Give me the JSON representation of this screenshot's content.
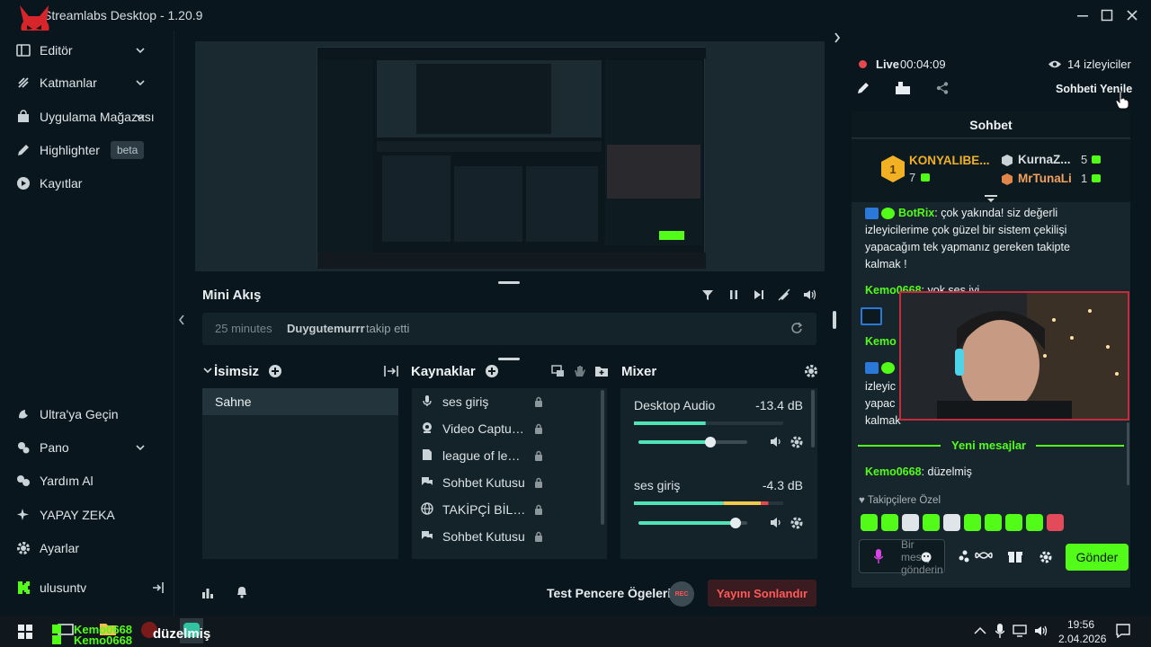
{
  "app": {
    "title": "Streamlabs Desktop - 1.20.9"
  },
  "sidebar": {
    "items": [
      {
        "label": "Editör",
        "icon": "layout-icon",
        "chevron": true
      },
      {
        "label": "Katmanlar",
        "icon": "layers-icon",
        "chevron": true
      },
      {
        "label": "Uygulama Mağazası",
        "icon": "store-icon",
        "chevron": true
      },
      {
        "label": "Highlighter",
        "icon": "highlighter-icon",
        "badge": "beta"
      },
      {
        "label": "Kayıtlar",
        "icon": "play-icon"
      }
    ],
    "bottom_items": [
      {
        "label": "Ultra'ya Geçin",
        "icon": "ultra-icon"
      },
      {
        "label": "Pano",
        "icon": "dashboard-icon",
        "chevron": true
      },
      {
        "label": "Yardım Al",
        "icon": "help-icon"
      },
      {
        "label": "YAPAY ZEKA",
        "icon": "sparkle-icon"
      },
      {
        "label": "Ayarlar",
        "icon": "gear-icon"
      }
    ],
    "account": {
      "label": "ulusuntv",
      "icon": "kick-icon"
    }
  },
  "mini_feed": {
    "title": "Mini Akış",
    "event_time": "25 minutes",
    "event_user": "Duygutemurrr",
    "event_action": "takip etti"
  },
  "scenes": {
    "title": "İsimsiz",
    "items": [
      "Sahne"
    ]
  },
  "sources": {
    "title": "Kaynaklar",
    "items": [
      {
        "label": "ses giriş",
        "icon": "mic-icon"
      },
      {
        "label": "Video Capture Device",
        "icon": "webcam-icon"
      },
      {
        "label": "league of legends",
        "icon": "game-icon"
      },
      {
        "label": "Sohbet Kutusu",
        "icon": "chat-icon"
      },
      {
        "label": "TAKİPÇİ BİLDİRİMİ",
        "icon": "globe-icon"
      },
      {
        "label": "Sohbet Kutusu",
        "icon": "chat-icon"
      }
    ]
  },
  "mixer": {
    "title": "Mixer",
    "channels": [
      {
        "name": "Desktop Audio",
        "db": "-13.4 dB",
        "level": 0.48,
        "volume": 0.66
      },
      {
        "name": "ses giriş",
        "db": "-4.3 dB",
        "level": 0.9,
        "volume": 0.89
      }
    ]
  },
  "footer": {
    "test_label": "Test Pencere Ögeleri",
    "rec_label": "REC",
    "end_stream_label": "Yayını Sonlandır"
  },
  "live": {
    "status": "Live",
    "elapsed": "00:04:09",
    "viewers": "14 izleyiciler",
    "refresh_label": "Sohbeti Yenile"
  },
  "chat": {
    "title": "Sohbet",
    "leaderboard": [
      {
        "rank": "1",
        "name": "KONYALIBE...",
        "count": "7"
      },
      {
        "rank": "",
        "name": "KurnaZ...",
        "count": "5"
      },
      {
        "rank": "",
        "name": "MrTunaLi",
        "count": "1"
      }
    ],
    "messages": [
      {
        "user": "BotRix",
        "text": "çok yakında! siz değerli izleyicilerime çok güzel bir sistem çekilişi yapacağım tek yapmanız gereken takipte kalmak !"
      },
      {
        "user": "Kemo0668",
        "text": "yok ses iyi"
      },
      {
        "user": "Kemo0668",
        "text": "düzelmiş"
      }
    ],
    "new_messages_label": "Yeni mesajlar",
    "followers_only_label": "Takipçilere Özel",
    "input_placeholder": "Bir mesaj gönderin",
    "send_label": "Gönder",
    "colors": {
      "kick_green": "#53fc18",
      "live_red": "#e5484d"
    }
  },
  "taskbar": {
    "overlay_user": "Kemo0668",
    "overlay_text": "düzelmiş",
    "time": "19:56",
    "date": "2.04.2026"
  }
}
